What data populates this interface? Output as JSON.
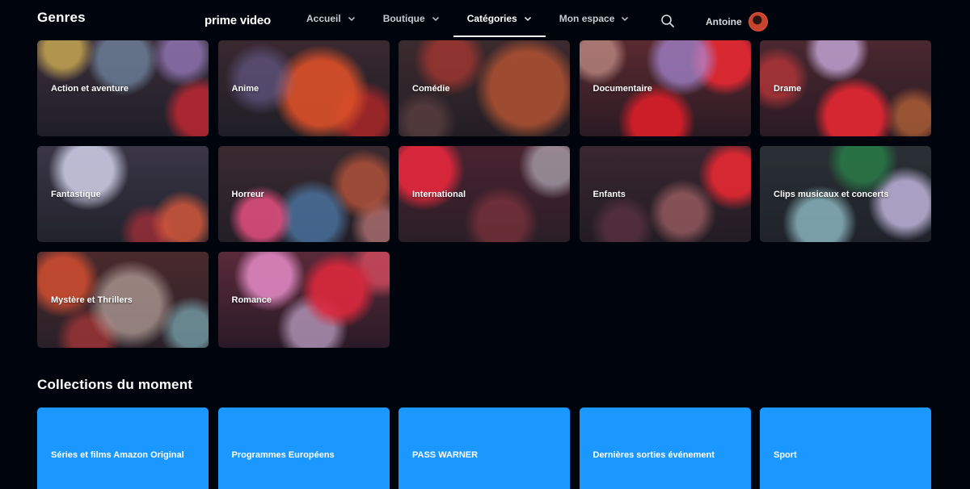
{
  "header": {
    "section_title": "Genres",
    "logo": "prime video",
    "nav": [
      {
        "label": "Accueil",
        "active": false
      },
      {
        "label": "Boutique",
        "active": false
      },
      {
        "label": "Catégories",
        "active": true
      },
      {
        "label": "Mon espace",
        "active": false
      }
    ],
    "user_name": "Antoine"
  },
  "genres": [
    "Action et aventure",
    "Anime",
    "Comédie",
    "Documentaire",
    "Drame",
    "Fantastique",
    "Horreur",
    "International",
    "Enfants",
    "Clips musicaux et concerts",
    "Mystère et Thrillers",
    "Romance"
  ],
  "collections": {
    "title": "Collections du moment",
    "items": [
      "Séries et films Amazon Original",
      "Programmes Européens",
      "PASS WARNER",
      "Dernières sorties événement",
      "Sport"
    ]
  },
  "colors": {
    "background": "#00050d",
    "collection_tile": "#1a98ff",
    "text": "#ffffff"
  }
}
